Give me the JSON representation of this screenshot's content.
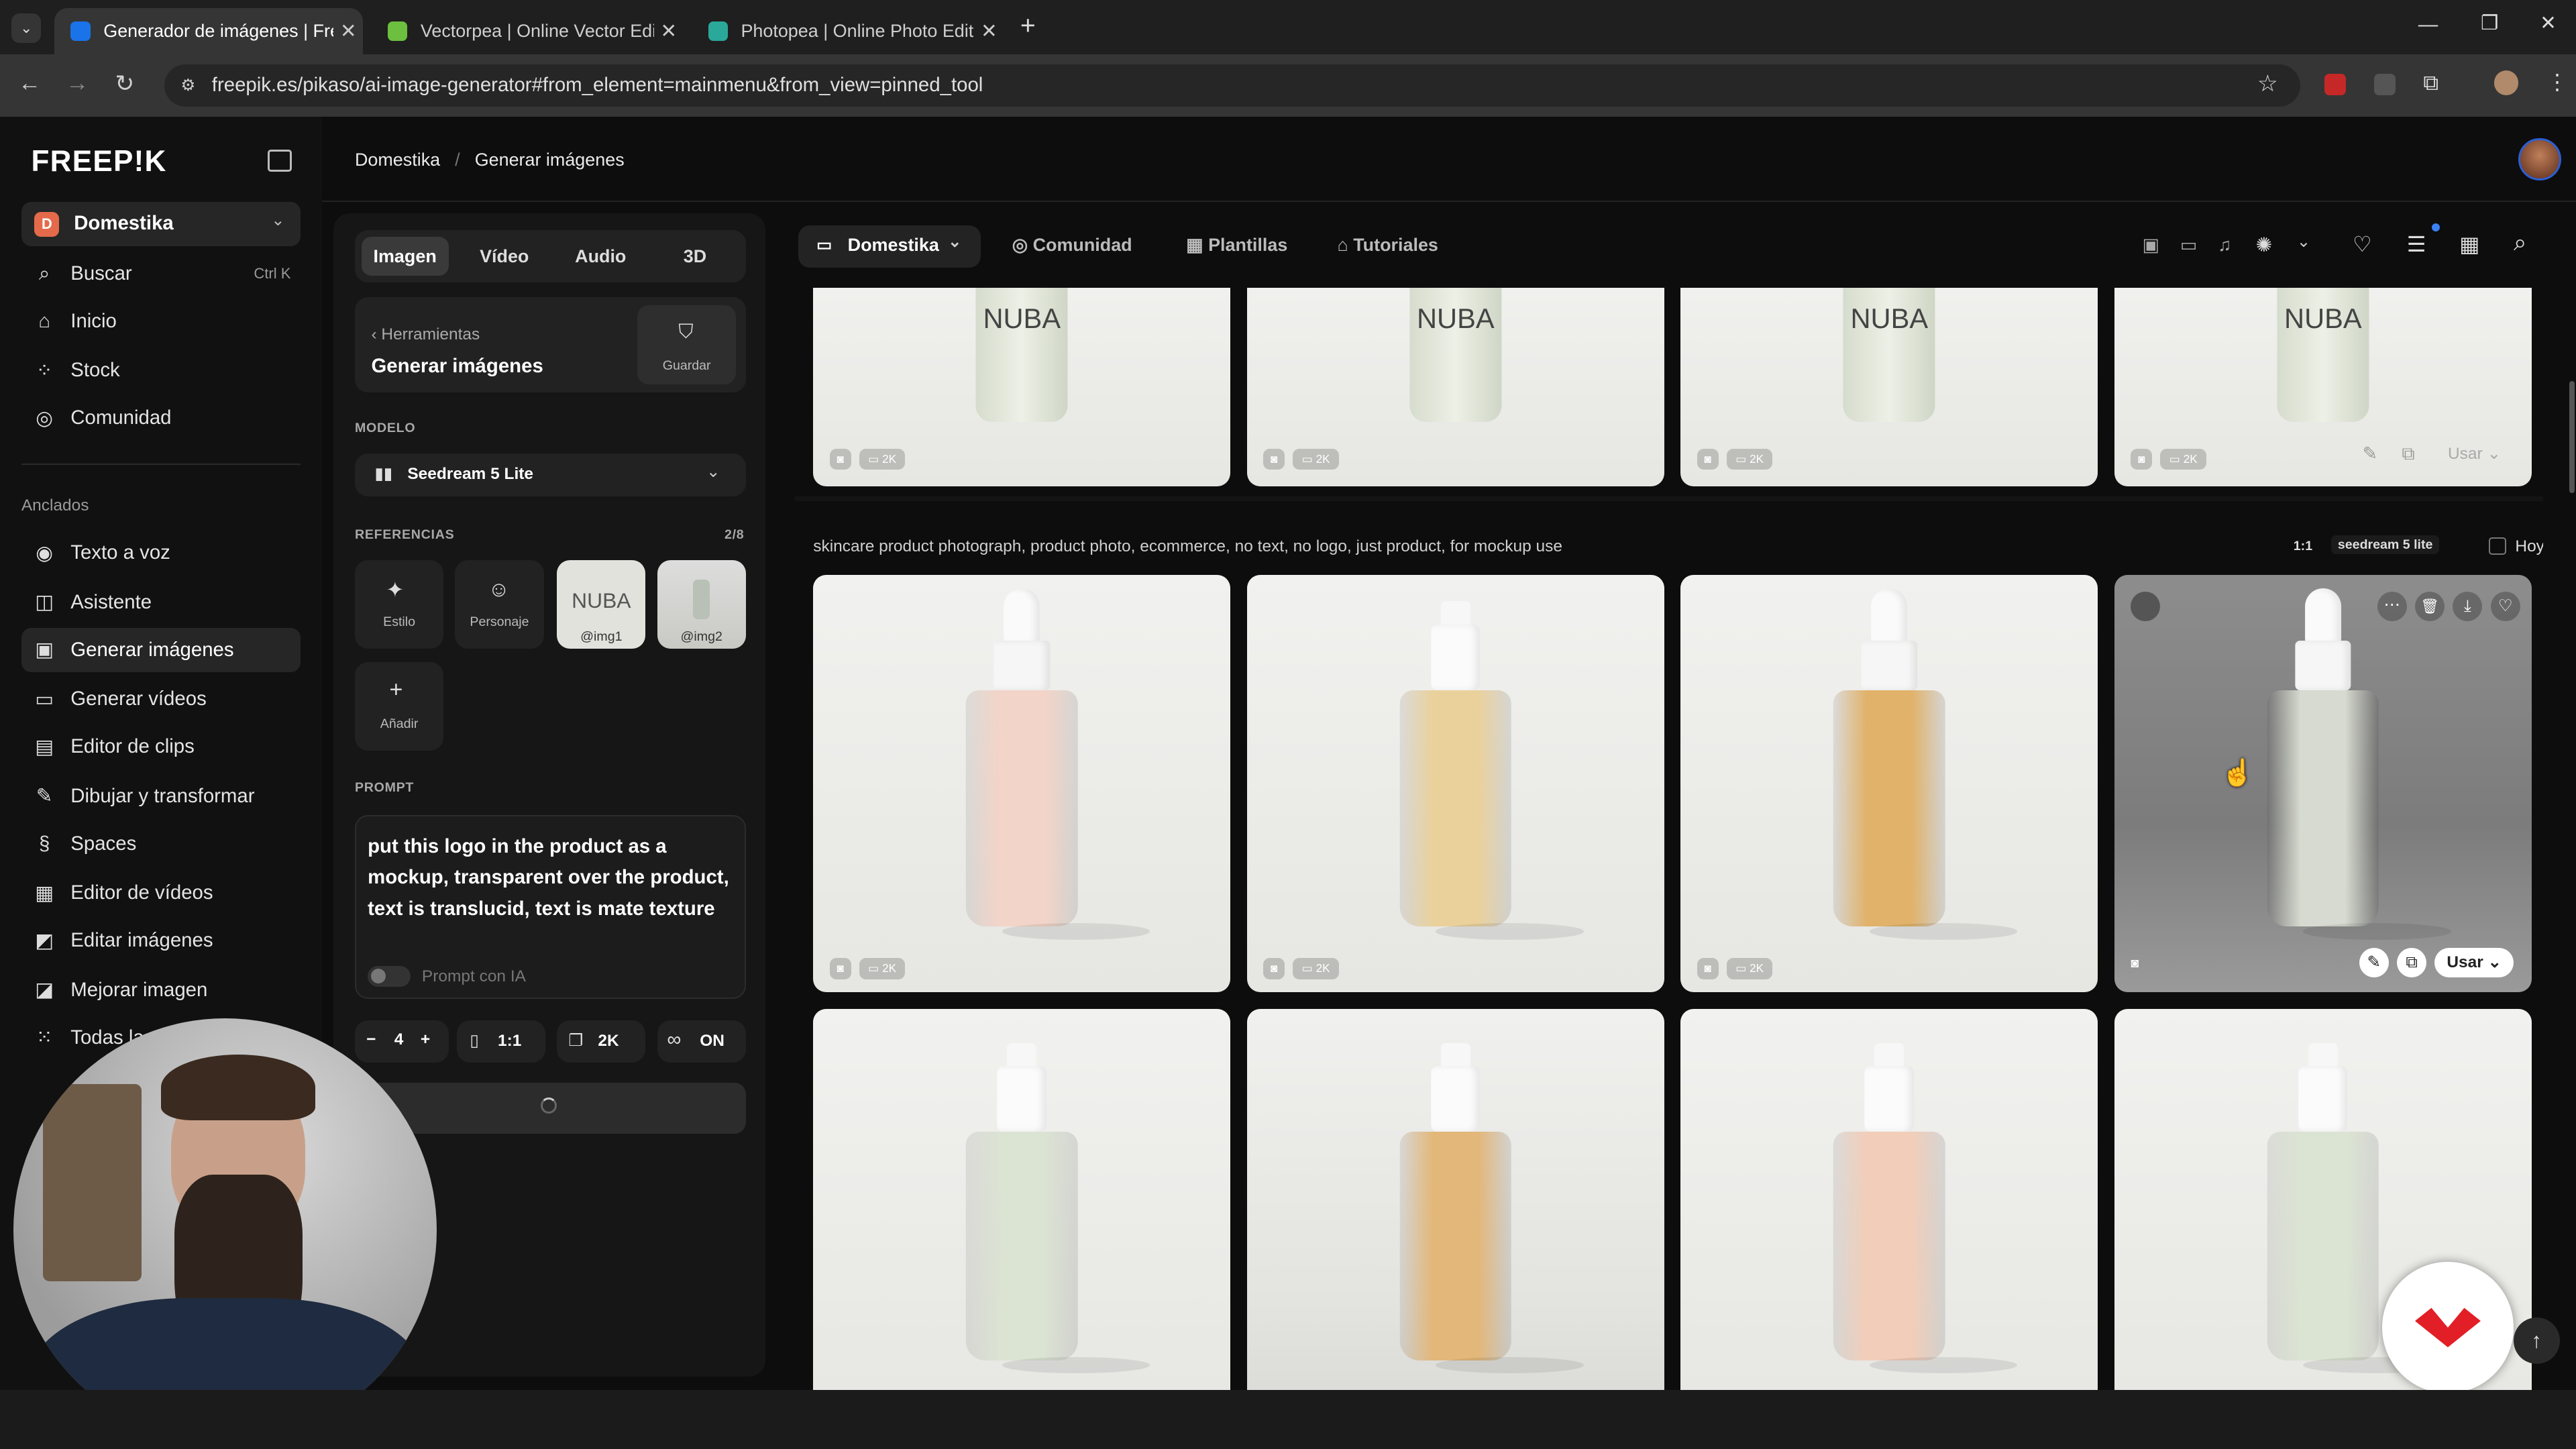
{
  "browser": {
    "tabs": [
      {
        "title": "Generador de imágenes | Freep",
        "color": "#1a73e8"
      },
      {
        "title": "Vectorpea | Online Vector Edito",
        "color": "#6dbf3f"
      },
      {
        "title": "Photopea | Online Photo Editor",
        "color": "#2aa89a"
      }
    ],
    "new_tab": "+",
    "url": "freepik.es/pikaso/ai-image-generator#from_element=mainmenu&from_view=pinned_tool"
  },
  "app": {
    "logo": "FREEP!K",
    "workspace": "Domestika",
    "workspace_initial": "D",
    "search": {
      "label": "Buscar",
      "shortcut": "Ctrl K"
    },
    "nav_main": [
      "Inicio",
      "Stock",
      "Comunidad"
    ],
    "pinned_title": "Anclados",
    "nav_pinned": [
      "Texto a voz",
      "Asistente",
      "Generar imágenes",
      "Generar vídeos",
      "Editor de clips",
      "Dibujar y transformar",
      "Spaces",
      "Editor de vídeos",
      "Editar imágenes",
      "Mejorar imagen",
      "Todas las"
    ],
    "active_item": "Generar imágenes"
  },
  "breadcrumb": [
    "Domestika",
    "Generar imágenes"
  ],
  "panel": {
    "tabs": [
      "Imagen",
      "Vídeo",
      "Audio",
      "3D"
    ],
    "back_label": "Herramientas",
    "title": "Generar imágenes",
    "save_label": "Guardar",
    "model_label": "MODELO",
    "model": "Seedream 5 Lite",
    "refs_label": "REFERENCIAS",
    "refs_count": "2/8",
    "ref_style": "Estilo",
    "ref_character": "Personaje",
    "ref_img1": "@img1",
    "ref_img2": "@img2",
    "ref_img1_text": "NUBA",
    "add_label": "Añadir",
    "prompt_label": "PROMPT",
    "prompt": "put this logo in the product as a mockup, transparent over the product, text is translucid, text is mate texture",
    "ai_prompt_label": "Prompt con IA",
    "count": "4",
    "minus": "−",
    "plus": "+",
    "ratio": "1:1",
    "resolution": "2K",
    "on_label": "ON"
  },
  "main": {
    "workspace_btn": "Domestika",
    "tabs": [
      "Comunidad",
      "Plantillas",
      "Tutoriales"
    ],
    "top_row_text": "NUBA",
    "badge_2k": "2K",
    "use_label": "Usar",
    "prompt_bar": "skincare product photograph, product photo, ecommerce, no text, no logo, just product, for mockup use",
    "prompt_ratio": "1:1",
    "prompt_model": "seedream 5 lite",
    "prompt_date": "Hoy",
    "liquid_colors": [
      "#f3d4c8",
      "#ead19c",
      "#e1b26a",
      "#d7dad0",
      "#dbe3d3",
      "#e3b779",
      "#f2cdb9",
      "#dbe4d2"
    ]
  }
}
